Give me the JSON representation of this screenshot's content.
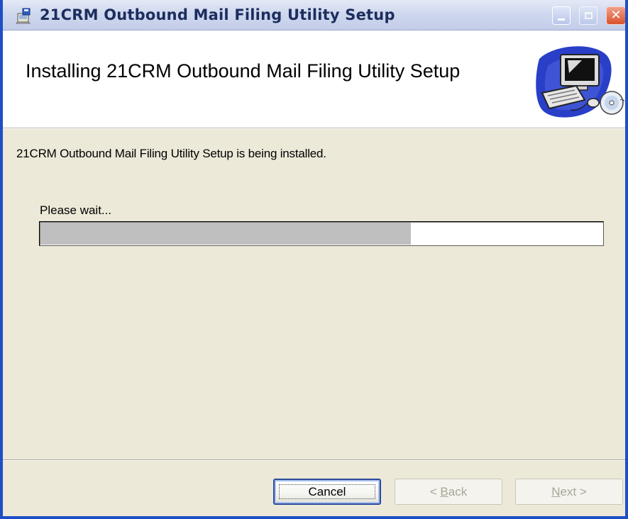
{
  "window": {
    "title": "21CRM Outbound Mail Filing Utility Setup",
    "controls": {
      "minimize": "minimize",
      "maximize": "maximize",
      "close": "close"
    }
  },
  "banner": {
    "title": "Installing 21CRM Outbound Mail Filing Utility Setup",
    "graphic_icon": "computer-with-cd-icon"
  },
  "body": {
    "status_text": "21CRM Outbound Mail Filing Utility Setup is being installed.",
    "progress_label": "Please wait...",
    "progress_fraction": 0.66
  },
  "footer": {
    "cancel_label": "Cancel",
    "back_prefix": "< ",
    "back_accel": "B",
    "back_rest": "ack",
    "next_accel": "N",
    "next_rest": "ext",
    "next_suffix": " >",
    "back_enabled": false,
    "next_enabled": false
  },
  "colors": {
    "window_border": "#1f4fc6",
    "dialog_face": "#ece9d8",
    "progress_fill": "#bfbfbf",
    "close_button": "#d9532c"
  }
}
